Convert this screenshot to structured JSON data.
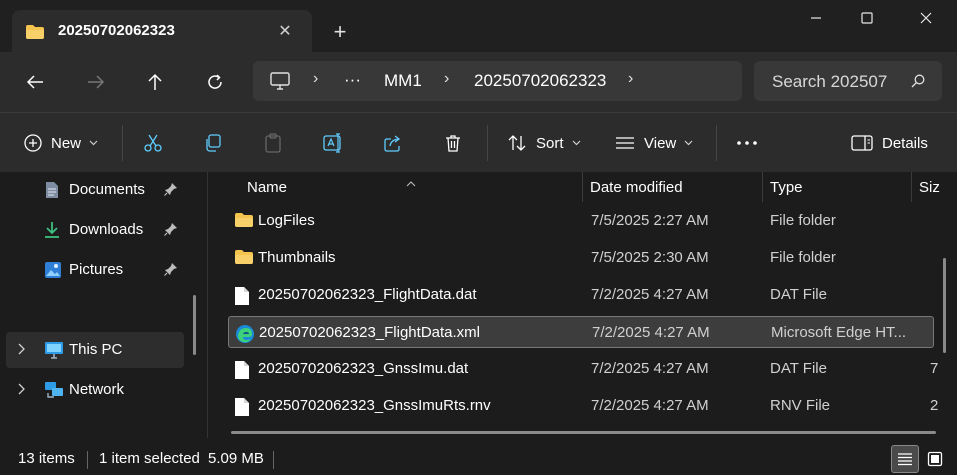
{
  "tab": {
    "title": "20250702062323",
    "close_glyph": "✕",
    "new_glyph": "+"
  },
  "window": {
    "minimize": "—",
    "maximize": "☐",
    "close": "✕"
  },
  "address": {
    "overflow": "···",
    "crumbs": [
      "MM1",
      "20250702062323"
    ],
    "sep": "›"
  },
  "search": {
    "placeholder": "Search 202507"
  },
  "commands": {
    "new_label": "New",
    "sort_label": "Sort",
    "view_label": "View",
    "more_label": "•••",
    "details_label": "Details",
    "chevron": "⌄"
  },
  "sidebar": {
    "items": [
      {
        "label": "Documents",
        "icon": "documents-icon",
        "pinned": true
      },
      {
        "label": "Downloads",
        "icon": "downloads-icon",
        "pinned": true
      },
      {
        "label": "Pictures",
        "icon": "pictures-icon",
        "pinned": true
      },
      {
        "label": "This PC",
        "icon": "this-pc-icon",
        "selected": true
      },
      {
        "label": "Network",
        "icon": "network-icon"
      }
    ],
    "expander": "›"
  },
  "columns": {
    "name": "Name",
    "date": "Date modified",
    "type": "Type",
    "size": "Siz"
  },
  "files": [
    {
      "name": "LogFiles",
      "date": "7/5/2025 2:27 AM",
      "type": "File folder",
      "size": "",
      "icon": "folder-icon"
    },
    {
      "name": "Thumbnails",
      "date": "7/5/2025 2:30 AM",
      "type": "File folder",
      "size": "",
      "icon": "folder-icon"
    },
    {
      "name": "20250702062323_FlightData.dat",
      "date": "7/2/2025 4:27 AM",
      "type": "DAT File",
      "size": "",
      "icon": "file-icon"
    },
    {
      "name": "20250702062323_FlightData.xml",
      "date": "7/2/2025 4:27 AM",
      "type": "Microsoft Edge HT...",
      "size": "",
      "icon": "edge-icon",
      "selected": true
    },
    {
      "name": "20250702062323_GnssImu.dat",
      "date": "7/2/2025 4:27 AM",
      "type": "DAT File",
      "size": "7",
      "icon": "file-icon"
    },
    {
      "name": "20250702062323_GnssImuRts.rnv",
      "date": "7/2/2025 4:27 AM",
      "type": "RNV File",
      "size": "2",
      "icon": "file-icon"
    }
  ],
  "status": {
    "count": "13 items",
    "selection": "1 item selected",
    "size": "5.09 MB"
  },
  "colors": {
    "background": "#1c1c1c",
    "chrome": "#2c2c2c",
    "folder": "#f4c44e",
    "accent": "#60cdff"
  }
}
